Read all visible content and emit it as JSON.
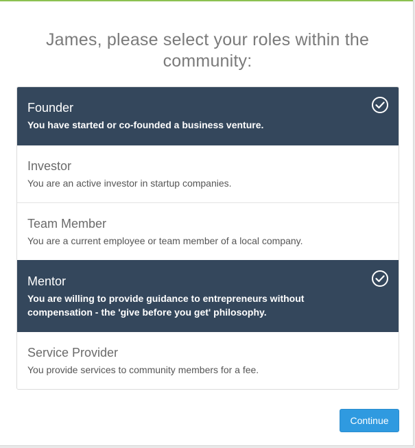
{
  "heading": "James, please select your roles within the community:",
  "roles": [
    {
      "title": "Founder",
      "description": "You have started or co-founded a business venture.",
      "selected": true
    },
    {
      "title": "Investor",
      "description": "You are an active investor in startup companies.",
      "selected": false
    },
    {
      "title": "Team Member",
      "description": "You are a current employee or team member of a local company.",
      "selected": false
    },
    {
      "title": "Mentor",
      "description": "You are willing to provide guidance to entrepreneurs without compensation - the 'give before you get' philosophy.",
      "selected": true
    },
    {
      "title": "Service Provider",
      "description": "You provide services to community members for a fee.",
      "selected": false
    }
  ],
  "continue_label": "Continue",
  "colors": {
    "selected_background": "#34475c",
    "accent_bar": "#8cc152",
    "button": "#2f9ae0"
  },
  "icons": {
    "selected_marker": "check-circle-icon"
  }
}
